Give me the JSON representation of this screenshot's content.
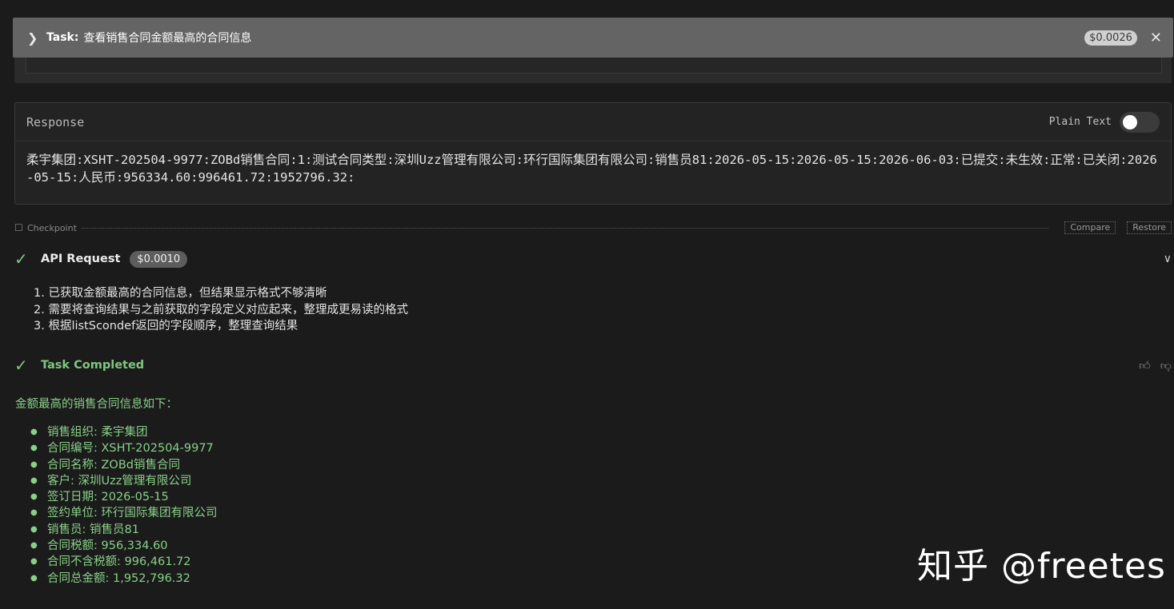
{
  "task": {
    "label": "Task:",
    "text": "查看销售合同金额最高的合同信息",
    "cost": "$0.0026"
  },
  "response": {
    "title": "Response",
    "plain_text_label": "Plain Text",
    "plain_text_enabled": false,
    "body": "柔宇集团:XSHT-202504-9977:ZOBd销售合同:1:测试合同类型:深圳Uzz管理有限公司:环行国际集团有限公司:销售员81:2026-05-15:2026-05-15:2026-06-03:已提交:未生效:正常:已关闭:2026-05-15:人民币:956334.60:996461.72:1952796.32:"
  },
  "checkpoint": {
    "label": "Checkpoint",
    "compare": "Compare",
    "restore": "Restore"
  },
  "api_request": {
    "label": "API Request",
    "cost": "$0.0010",
    "steps": [
      "1. 已获取金额最高的合同信息，但结果显示格式不够清晰",
      "2. 需要将查询结果与之前获取的字段定义对应起来，整理成更易读的格式",
      "3. 根据listScondef返回的字段顺序，整理查询结果"
    ]
  },
  "completed": {
    "label": "Task Completed",
    "summary_title": "金额最高的销售合同信息如下：",
    "items": [
      "销售组织: 柔宇集团",
      "合同编号: XSHT-202504-9977",
      "合同名称: ZOBd销售合同",
      "客户: 深圳Uzz管理有限公司",
      "签订日期: 2026-05-15",
      "签约单位: 环行国际集团有限公司",
      "销售员: 销售员81",
      "合同税额: 956,334.60",
      "合同不含税额: 996,461.72",
      "合同总金额: 1,952,796.32"
    ]
  },
  "watermark": "知乎 @freetes",
  "colors": {
    "background": "#1b1b1b",
    "task_bar": "#646464",
    "success_green": "#7dc87d"
  }
}
